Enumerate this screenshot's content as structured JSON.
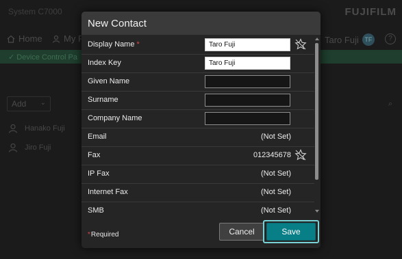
{
  "background": {
    "app_name": "System C7000",
    "brand": "FUJIFILM",
    "nav": {
      "home": "Home",
      "my": "My P",
      "user": "Taro Fuji",
      "user_initials": "TF",
      "help": "?"
    },
    "banner": "Device Control Pa",
    "add_label": "Add",
    "contacts": [
      "Hanako Fuji",
      "Jiro Fuji"
    ]
  },
  "modal": {
    "title": "New Contact",
    "fields": [
      {
        "label": "Display Name",
        "required": "*",
        "value": "Taro Fuji",
        "type": "input",
        "favorite": true
      },
      {
        "label": "Index Key",
        "value": "Taro Fuji",
        "type": "input"
      },
      {
        "label": "Given Name",
        "value": "",
        "type": "input"
      },
      {
        "label": "Surname",
        "value": "",
        "type": "input"
      },
      {
        "label": "Company Name",
        "value": "",
        "type": "input"
      },
      {
        "label": "Email",
        "value": "(Not Set)",
        "type": "text"
      },
      {
        "label": "Fax",
        "value": "012345678",
        "type": "text",
        "favorite": true
      },
      {
        "label": "IP Fax",
        "value": "(Not Set)",
        "type": "text"
      },
      {
        "label": "Internet Fax",
        "value": "(Not Set)",
        "type": "text"
      },
      {
        "label": "SMB",
        "value": "(Not Set)",
        "type": "text"
      }
    ],
    "footer": {
      "required_star": "*",
      "required_label": "Required",
      "cancel_label": "Cancel",
      "save_label": "Save"
    }
  },
  "colors": {
    "accent": "#087e87",
    "focus_ring": "#79d3d6",
    "required": "#e0434d"
  }
}
